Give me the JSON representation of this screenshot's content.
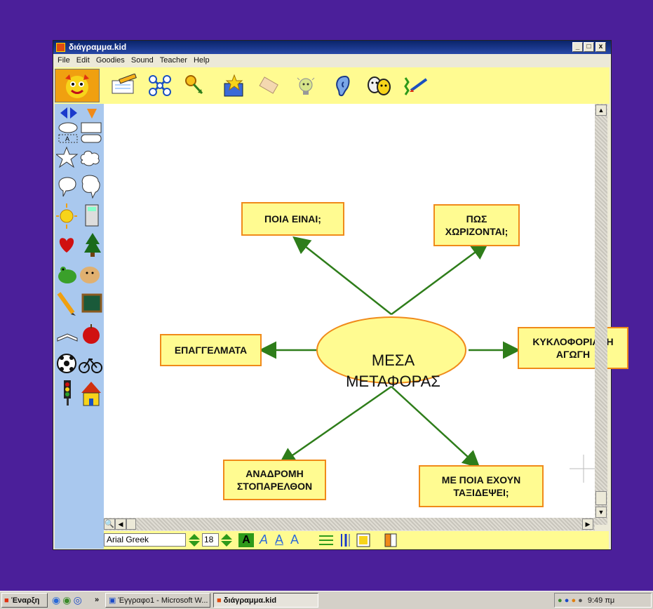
{
  "window": {
    "title": "διάγραμμα.kid",
    "controls": {
      "minimize": "_",
      "maximize": "□",
      "close": "x"
    }
  },
  "menu": [
    "File",
    "Edit",
    "Goodies",
    "Sound",
    "Teacher",
    "Help"
  ],
  "diagram": {
    "center": [
      "ΜΕΣΑ",
      "ΜΕΤΑΦΟΡΑΣ"
    ],
    "nodes": {
      "top_left": [
        "ΠΟΙΑ ΕΙΝΑΙ;"
      ],
      "top_right": [
        "ΠΩΣ",
        "ΧΩΡΙΖΟΝΤΑΙ;"
      ],
      "left": [
        "ΕΠΑΓΓΕΛΜΑΤΑ"
      ],
      "right": [
        "ΚΥΚΛΟΦΟΡΙΑΚΗ",
        "ΑΓΩΓΗ"
      ],
      "bottom_left": [
        "ΑΝΑΔΡΟΜΗ",
        "ΣΤΟΠΑΡΕΛΘΟΝ"
      ],
      "bottom_right": [
        "ΜΕ ΠΟΙΑ ΕΧΟΥΝ",
        "ΤΑΞΙΔΕΨΕΙ;"
      ]
    },
    "colors": {
      "box_fill": "#fffb91",
      "box_border": "#f08a1a",
      "arrow": "#2e7d1a",
      "center_fill": "#fffb91"
    }
  },
  "format_bar": {
    "font": "Arial Greek",
    "size": "18",
    "bold_label": "A",
    "italic_label": "A",
    "underline_label": "A",
    "superscript_label": "A"
  },
  "taskbar": {
    "start_label": "Έναρξη",
    "overflow": "»",
    "tasks": [
      "Έγγραφο1 - Microsoft W...",
      "διάγραμμα.kid"
    ],
    "clock": "9:49 πμ"
  }
}
